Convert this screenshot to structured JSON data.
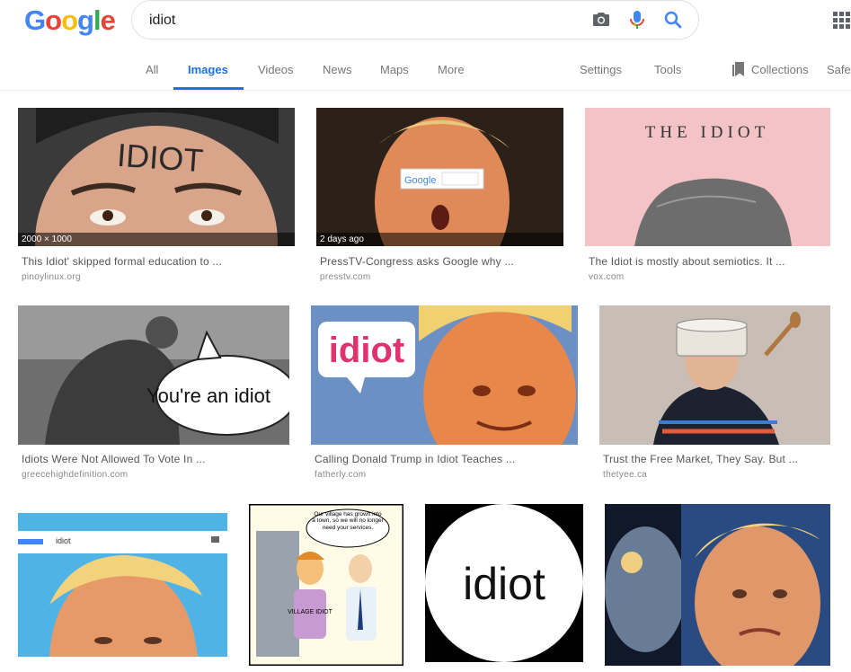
{
  "logo": {
    "letters": [
      "G",
      "o",
      "o",
      "g",
      "l",
      "e"
    ],
    "colors": [
      "#4285F4",
      "#EA4335",
      "#FBBC05",
      "#4285F4",
      "#34A853",
      "#EA4335"
    ]
  },
  "search": {
    "value": "idiot"
  },
  "tabs": {
    "all": "All",
    "images": "Images",
    "videos": "Videos",
    "news": "News",
    "maps": "Maps",
    "more": "More",
    "settings": "Settings",
    "tools": "Tools",
    "collections": "Collections",
    "safe": "Safe"
  },
  "accent": "#1a73e8",
  "results": [
    {
      "overlay": "2000 × 1000",
      "caption": "This Idiot' skipped formal education to ...",
      "source": "pinoylinux.org",
      "image_text": "IDIOT"
    },
    {
      "overlay": "2 days ago",
      "caption": "PressTV-Congress asks Google why ...",
      "source": "presstv.com",
      "image_text": "Google"
    },
    {
      "caption": "The Idiot is mostly about semiotics. It ...",
      "source": "vox.com",
      "image_text": "THE IDIOT"
    },
    {
      "caption": "Idiots Were Not Allowed To Vote In ...",
      "source": "greecehighdefinition.com",
      "image_text": "You're an idiot"
    },
    {
      "caption": "Calling Donald Trump in Idiot Teaches ...",
      "source": "fatherly.com",
      "image_text": "idiot"
    },
    {
      "caption": "Trust the Free Market, They Say. But ...",
      "source": "thetyee.ca"
    },
    {
      "image_text": "idiot"
    },
    {
      "image_text": "Our village has grown into a town, so we will no longer need your services.",
      "image_text_2": "VILLAGE IDIOT"
    },
    {
      "image_text": "idiot"
    },
    {}
  ]
}
